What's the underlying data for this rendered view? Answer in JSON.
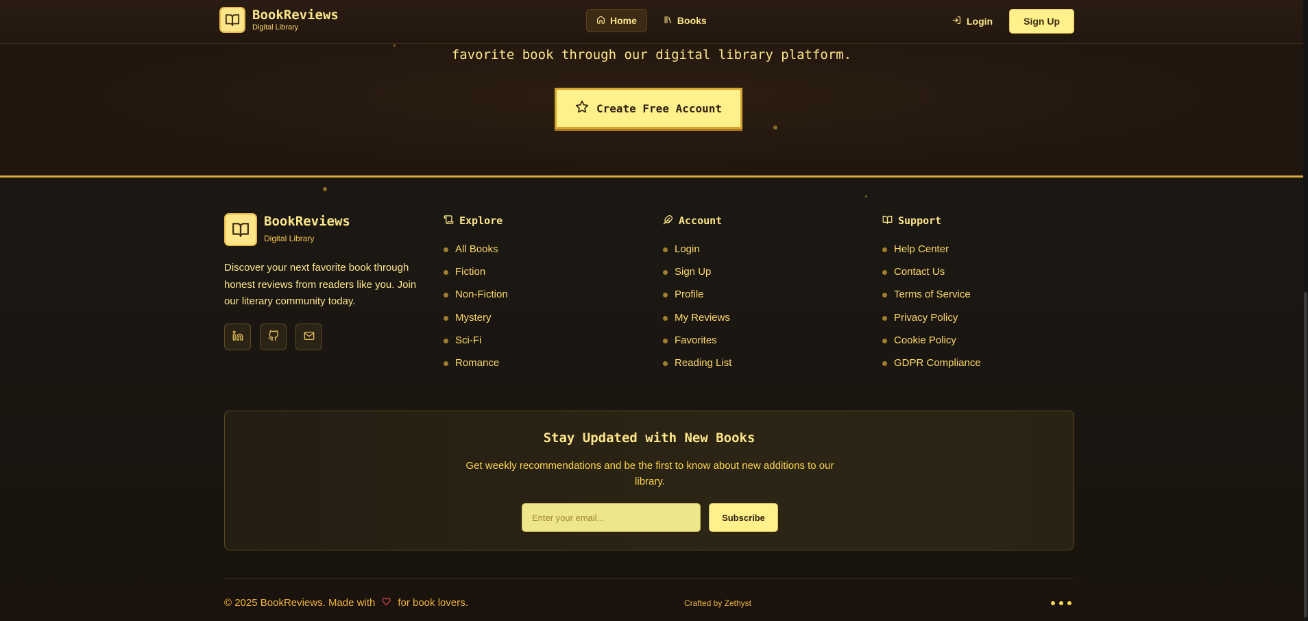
{
  "header": {
    "brand_name": "BookReviews",
    "brand_sub": "Digital Library",
    "nav": [
      {
        "label": "Home",
        "icon": "home-icon"
      },
      {
        "label": "Books",
        "icon": "library-icon"
      }
    ],
    "login_label": "Login",
    "signup_label": "Sign Up"
  },
  "hero": {
    "tagline_tail": "favorite book through our digital library platform.",
    "cta_label": "Create Free Account"
  },
  "footer": {
    "brand_name": "BookReviews",
    "brand_sub": "Digital Library",
    "description": "Discover your next favorite book through honest reviews from readers like you. Join our literary community today.",
    "columns": [
      {
        "title": "Explore",
        "icon": "scroll-icon",
        "links": [
          "All Books",
          "Fiction",
          "Non-Fiction",
          "Mystery",
          "Sci-Fi",
          "Romance"
        ]
      },
      {
        "title": "Account",
        "icon": "feather-icon",
        "links": [
          "Login",
          "Sign Up",
          "Profile",
          "My Reviews",
          "Favorites",
          "Reading List"
        ]
      },
      {
        "title": "Support",
        "icon": "book-open-icon",
        "links": [
          "Help Center",
          "Contact Us",
          "Terms of Service",
          "Privacy Policy",
          "Cookie Policy",
          "GDPR Compliance"
        ]
      }
    ],
    "newsletter": {
      "title": "Stay Updated with New Books",
      "description": "Get weekly recommendations and be the first to know about new additions to our library.",
      "email_placeholder": "Enter your email...",
      "subscribe_label": "Subscribe"
    },
    "copyright_prefix": "© 2025 BookReviews. Made with",
    "copyright_suffix": "for book lovers.",
    "crafted_by": "Crafted by Zethyst"
  },
  "colors": {
    "accent": "#fde68a",
    "button": "#fef08a",
    "background": "#1a120c"
  }
}
